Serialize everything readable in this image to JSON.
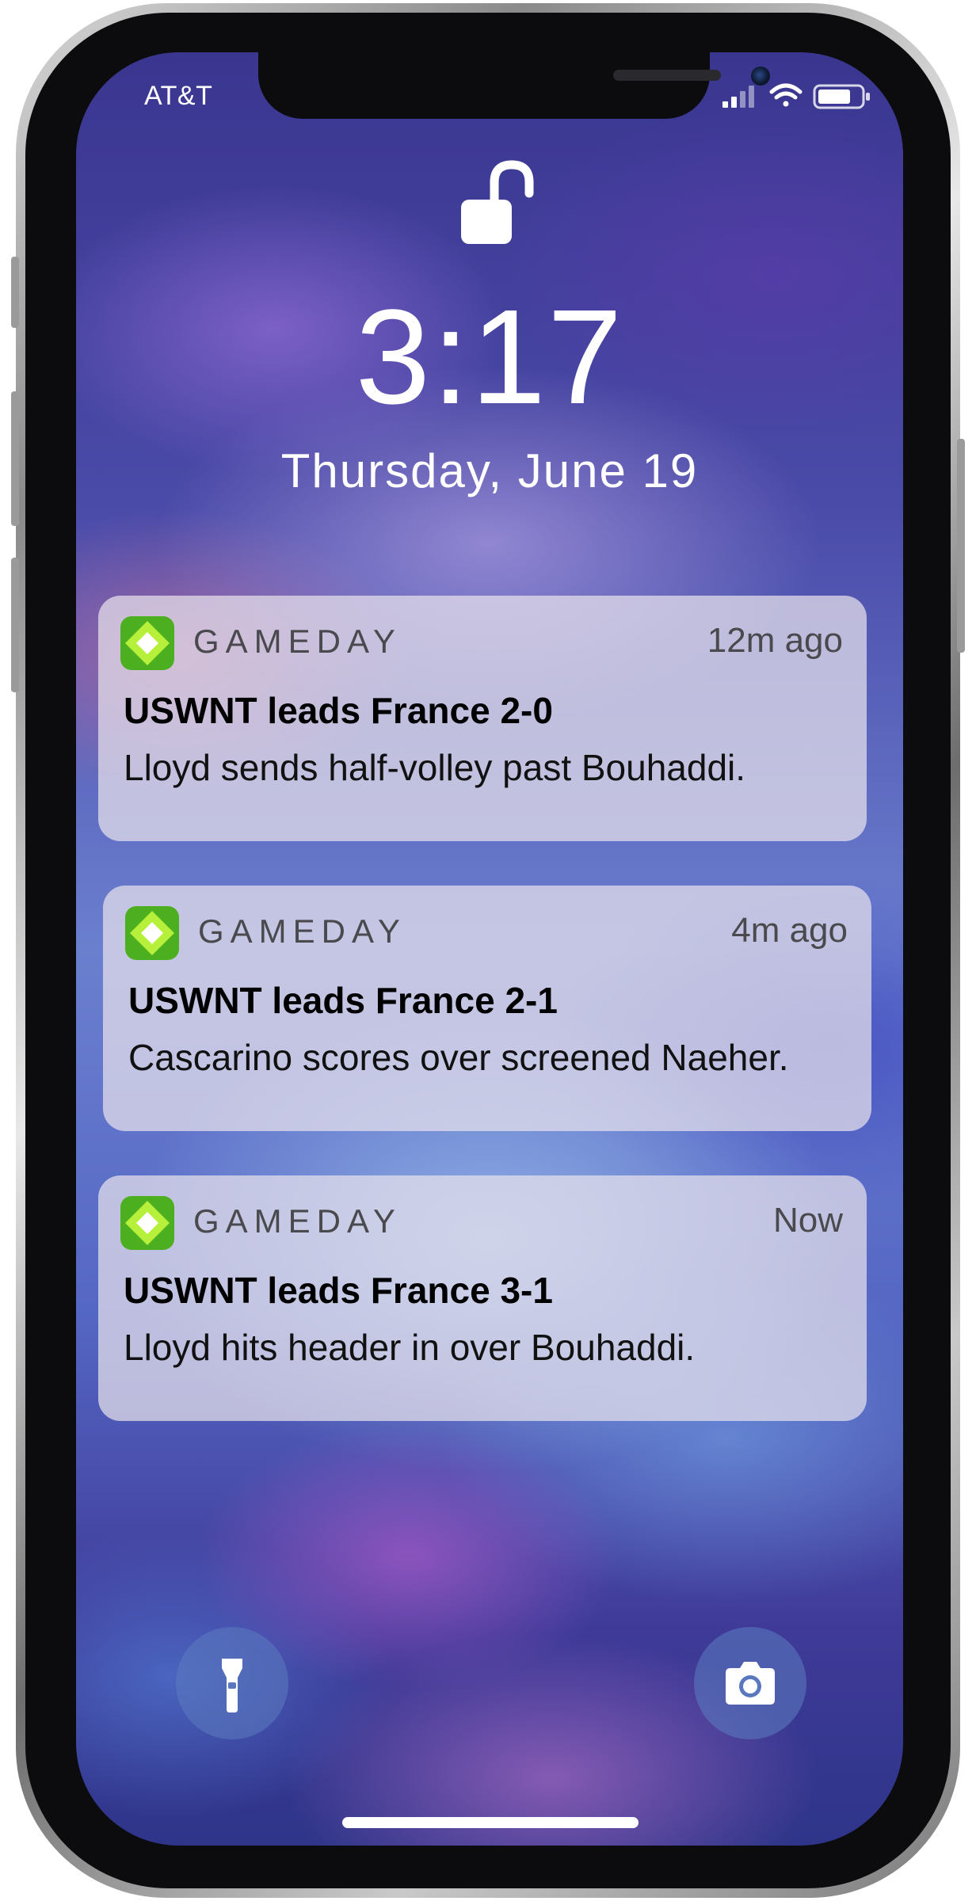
{
  "status_bar": {
    "carrier": "AT&T"
  },
  "lock_screen": {
    "time": "3:17",
    "date": "Thursday, June 19"
  },
  "notifications": [
    {
      "app": "GAMEDAY",
      "time_ago": "12m ago",
      "title": "USWNT leads France 2-0",
      "body": "Lloyd sends half-volley past Bouhaddi."
    },
    {
      "app": "GAMEDAY",
      "time_ago": "4m ago",
      "title": "USWNT leads France 2-1",
      "body": "Cascarino scores over screened Naeher."
    },
    {
      "app": "GAMEDAY",
      "time_ago": "Now",
      "title": "USWNT leads France 3-1",
      "body": "Lloyd hits header in over Bouhaddi."
    }
  ],
  "icons": {
    "lock": "unlocked-padlock-icon",
    "app": "gameday-diamond-icon",
    "flashlight": "flashlight-icon",
    "camera": "camera-icon",
    "signal": "cellular-signal-icon",
    "wifi": "wifi-icon",
    "battery": "battery-icon"
  },
  "colors": {
    "app_icon_green": "#4caf1f",
    "app_icon_lime": "#b6f03a",
    "notification_bg": "#e8e2ec"
  }
}
